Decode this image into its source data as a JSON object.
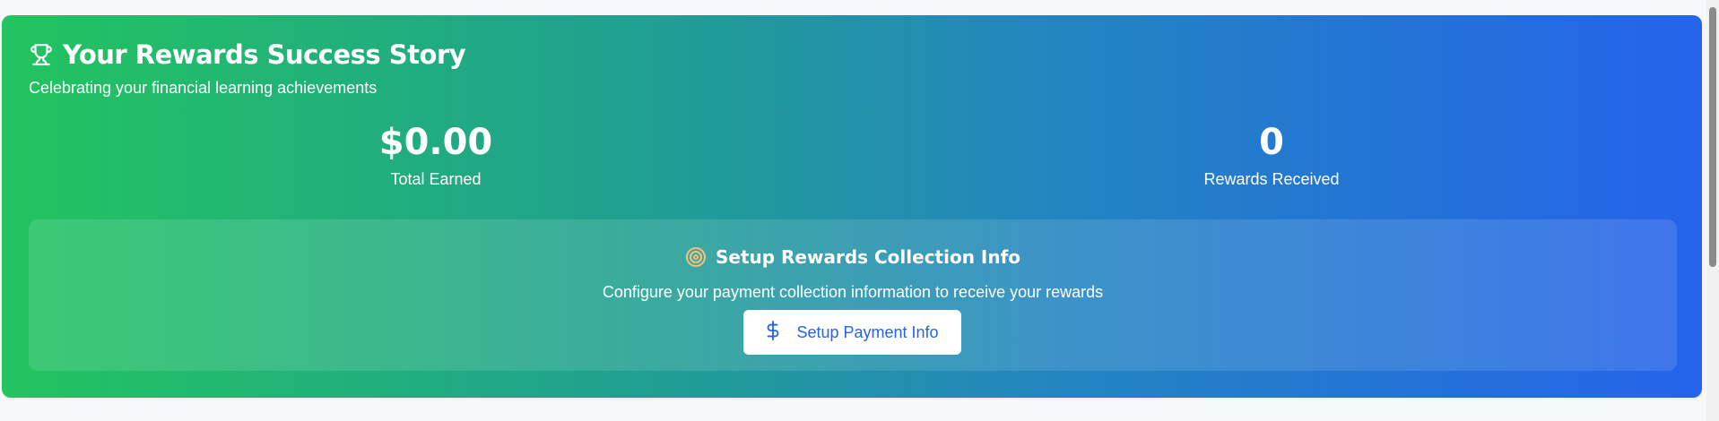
{
  "rewards": {
    "title": "Your Rewards Success Story",
    "subtitle": "Celebrating your financial learning achievements",
    "title_icon": "trophy-icon",
    "stats": {
      "total_earned_value": "$0.00",
      "total_earned_label": "Total Earned",
      "rewards_received_value": "0",
      "rewards_received_label": "Rewards Received"
    }
  },
  "setup": {
    "icon": "target-icon",
    "title": "Setup Rewards Collection Info",
    "description": "Configure your payment collection information to receive your rewards",
    "button_label": "Setup Payment Info",
    "button_icon": "dollar-sign-icon"
  },
  "colors": {
    "gradient_start": "#22c45f",
    "gradient_end": "#2563eb",
    "button_text": "#2563eb",
    "target_icon": "#f6c17a"
  }
}
